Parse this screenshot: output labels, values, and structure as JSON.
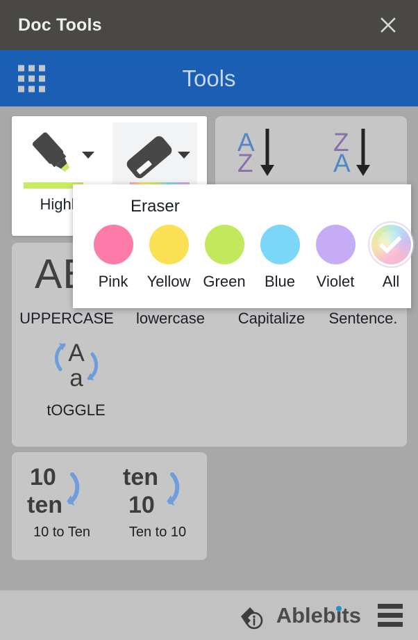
{
  "titlebar": {
    "title": "Doc Tools",
    "close_icon": "close-icon"
  },
  "header": {
    "title": "Tools",
    "grid_icon": "apps-grid-icon"
  },
  "highlight_card": {
    "highlighter": {
      "label": "Highli",
      "full_label": "Highlighter",
      "icon": "highlighter-marker-icon",
      "underline_color": "#c8eb63"
    },
    "eraser": {
      "label": "Eraser",
      "icon": "eraser-icon",
      "active": true
    }
  },
  "sort": {
    "az": {
      "top_letter": "A",
      "bottom_letter": "Z",
      "top_color": "#4f87c9",
      "bottom_color": "#8a6fa8",
      "icon": "sort-a-to-z-icon"
    },
    "za": {
      "top_letter": "Z",
      "bottom_letter": "A",
      "top_color": "#8a6fa8",
      "bottom_color": "#4f87c9",
      "icon": "sort-z-to-a-icon"
    }
  },
  "case_panel": {
    "glyph": "AB",
    "options": [
      {
        "label": "UPPERCASE"
      },
      {
        "label": "lowercase"
      },
      {
        "label": "Capitalize"
      },
      {
        "label": "Sentence."
      }
    ],
    "toggle": {
      "label": "tOGGLE",
      "icon": "toggle-case-icon",
      "upper": "A",
      "lower": "a"
    }
  },
  "numbers_panel": {
    "items": [
      {
        "label": "10 to Ten",
        "from": "10",
        "to": "ten",
        "icon": "number-to-word-icon"
      },
      {
        "label": "Ten to 10",
        "from": "ten",
        "to": "10",
        "icon": "word-to-number-icon"
      }
    ]
  },
  "eraser_dropdown": {
    "title": "Eraser",
    "colors": [
      {
        "label": "Pink",
        "hex": "#fc7ba8",
        "selected": false
      },
      {
        "label": "Yellow",
        "hex": "#fbe054",
        "selected": false
      },
      {
        "label": "Green",
        "hex": "#c2e85c",
        "selected": false
      },
      {
        "label": "Blue",
        "hex": "#7bd6f7",
        "selected": false
      },
      {
        "label": "Violet",
        "hex": "#c6acf5",
        "selected": false
      },
      {
        "label": "All",
        "hex": "rainbow",
        "selected": true
      }
    ]
  },
  "footer": {
    "brand": "Ablebits",
    "brand_icon": "ablebits-info-logo-icon",
    "menu_icon": "hamburger-menu-icon",
    "accent_color": "#2a8fc4"
  }
}
